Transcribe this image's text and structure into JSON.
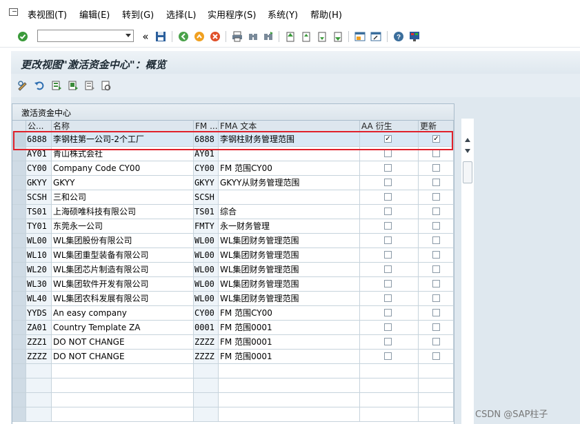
{
  "menu": {
    "items": [
      "表视图(T)",
      "编辑(E)",
      "转到(G)",
      "选择(L)",
      "实用程序(S)",
      "系统(Y)",
      "帮助(H)"
    ]
  },
  "toolbar": {
    "command_value": "",
    "icons": [
      "enter-icon",
      "back-nav-icon",
      "save-icon",
      "back-icon",
      "exit-icon",
      "cancel-icon",
      "print-icon",
      "find-icon",
      "find-next-icon",
      "first-page-icon",
      "previous-page-icon",
      "next-page-icon",
      "last-page-icon",
      "create-session-icon",
      "shortcut-icon",
      "help-icon",
      "layout-icon"
    ]
  },
  "page": {
    "title": "更改视图\"激活资金中心\"：概览"
  },
  "app_toolbar": {
    "icons": [
      "display-change-icon",
      "undo-icon",
      "select-all-icon",
      "select-block-icon",
      "deselect-all-icon",
      "variant-icon"
    ]
  },
  "table": {
    "title": "激活资金中心",
    "headers": [
      "公...",
      "名称",
      "FM ...",
      "FMA 文本",
      "AA 衍生",
      "更新"
    ],
    "rows": [
      {
        "code": "6888",
        "name": "李钢柱第一公司-2个工厂",
        "fm": "6888",
        "fm_text": "李钢柱财务管理范围",
        "aa": true,
        "upd": true
      },
      {
        "code": "AY01",
        "name": "青山株式会社",
        "fm": "AY01",
        "fm_text": "",
        "aa": false,
        "upd": false
      },
      {
        "code": "CY00",
        "name": "Company Code CY00",
        "fm": "CY00",
        "fm_text": "FM 范围CY00",
        "aa": false,
        "upd": false
      },
      {
        "code": "GKYY",
        "name": "GKYY",
        "fm": "GKYY",
        "fm_text": "GKYY从财务管理范围",
        "aa": false,
        "upd": false
      },
      {
        "code": "SCSH",
        "name": "三和公司",
        "fm": "SCSH",
        "fm_text": "",
        "aa": false,
        "upd": false
      },
      {
        "code": "TS01",
        "name": "上海硕唯科技有限公司",
        "fm": "TS01",
        "fm_text": "综合",
        "aa": false,
        "upd": false
      },
      {
        "code": "TY01",
        "name": "东莞永一公司",
        "fm": "FMTY",
        "fm_text": "永一财务管理",
        "aa": false,
        "upd": false
      },
      {
        "code": "WL00",
        "name": "WL集团股份有限公司",
        "fm": "WL00",
        "fm_text": "WL集团财务管理范围",
        "aa": false,
        "upd": false
      },
      {
        "code": "WL10",
        "name": "WL集团重型装备有限公司",
        "fm": "WL00",
        "fm_text": "WL集团财务管理范围",
        "aa": false,
        "upd": false
      },
      {
        "code": "WL20",
        "name": "WL集团芯片制造有限公司",
        "fm": "WL00",
        "fm_text": "WL集团财务管理范围",
        "aa": false,
        "upd": false
      },
      {
        "code": "WL30",
        "name": "WL集团软件开发有限公司",
        "fm": "WL00",
        "fm_text": "WL集团财务管理范围",
        "aa": false,
        "upd": false
      },
      {
        "code": "WL40",
        "name": "WL集团农科发展有限公司",
        "fm": "WL00",
        "fm_text": "WL集团财务管理范围",
        "aa": false,
        "upd": false
      },
      {
        "code": "YYDS",
        "name": "An easy company",
        "fm": "CY00",
        "fm_text": "FM 范围CY00",
        "aa": false,
        "upd": false
      },
      {
        "code": "ZA01",
        "name": "Country Template ZA",
        "fm": "0001",
        "fm_text": "FM 范围0001",
        "aa": false,
        "upd": false
      },
      {
        "code": "ZZZ1",
        "name": "DO NOT CHANGE",
        "fm": "ZZZZ",
        "fm_text": "FM 范围0001",
        "aa": false,
        "upd": false
      },
      {
        "code": "ZZZZ",
        "name": "DO NOT CHANGE",
        "fm": "ZZZZ",
        "fm_text": "FM 范围0001",
        "aa": false,
        "upd": false
      }
    ],
    "empty_rows": 4,
    "check_mark": "✓"
  },
  "watermark": "CSDN @SAP柱子",
  "colors": {
    "highlight": "#e0202a",
    "title_text": "#1e2b35"
  }
}
